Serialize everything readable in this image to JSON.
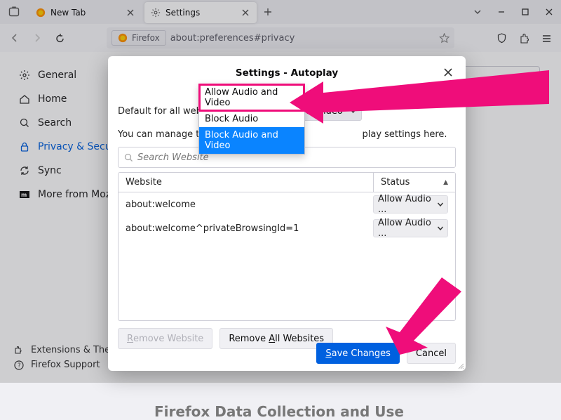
{
  "titlebar": {
    "tabs": [
      {
        "title": "New Tab",
        "active": false,
        "favicon": "firefox"
      },
      {
        "title": "Settings",
        "active": true,
        "favicon": "gear"
      }
    ]
  },
  "toolbar": {
    "identity_label": "Firefox",
    "url": "about:preferences#privacy"
  },
  "sidebar": {
    "items": [
      {
        "label": "General",
        "icon": "gear"
      },
      {
        "label": "Home",
        "icon": "home"
      },
      {
        "label": "Search",
        "icon": "search"
      },
      {
        "label": "Privacy & Security",
        "icon": "lock",
        "active": true
      },
      {
        "label": "Sync",
        "icon": "sync"
      },
      {
        "label": "More from Mozilla",
        "icon": "mozilla"
      }
    ],
    "bottom": [
      {
        "label": "Extensions & Themes",
        "icon": "puzzle"
      },
      {
        "label": "Firefox Support",
        "icon": "help"
      }
    ]
  },
  "page": {
    "section_heading": "Firefox Data Collection and Use"
  },
  "dialog": {
    "title": "Settings - Autoplay",
    "default_label": "Default for all websites:",
    "default_value": "Block Audio and Video",
    "manage_text_before": "You can manage the site",
    "manage_text_after": "play settings here.",
    "search_placeholder": "Search Website",
    "table": {
      "header_website": "Website",
      "header_status": "Status",
      "rows": [
        {
          "site": "about:welcome",
          "status": "Allow Audio ..."
        },
        {
          "site": "about:welcome^privateBrowsingId=1",
          "status": "Allow Audio ..."
        }
      ]
    },
    "buttons": {
      "remove_website": "Remove Website",
      "remove_all": "Remove All Websites",
      "save": "Save Changes",
      "cancel": "Cancel"
    },
    "dropdown_options": [
      "Allow Audio and Video",
      "Block Audio",
      "Block Audio and Video"
    ]
  }
}
